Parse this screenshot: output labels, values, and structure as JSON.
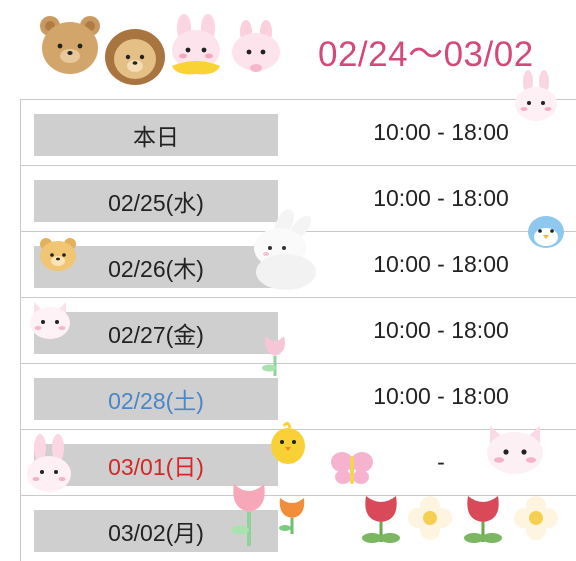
{
  "header": {
    "date_range": "02/24〜03/02",
    "date_color": "#d6487a"
  },
  "schedule": [
    {
      "day": "本日",
      "hours": "10:00 - 18:00",
      "day_color": "#222222"
    },
    {
      "day": "02/25(水)",
      "hours": "10:00 - 18:00",
      "day_color": "#222222"
    },
    {
      "day": "02/26(木)",
      "hours": "10:00 - 18:00",
      "day_color": "#222222"
    },
    {
      "day": "02/27(金)",
      "hours": "10:00 - 18:00",
      "day_color": "#222222"
    },
    {
      "day": "02/28(土)",
      "hours": "10:00 - 18:00",
      "day_color": "#4a86c8"
    },
    {
      "day": "03/01(日)",
      "hours": "-",
      "day_color": "#d32828"
    },
    {
      "day": "03/02(月)",
      "hours": "",
      "day_color": "#222222"
    }
  ],
  "icons": [
    "teddy-bear-icon",
    "lion-icon",
    "bunny-with-scarf-icon",
    "bunny-head-icon",
    "bunny-sticker-icon",
    "bird-icon",
    "bear-face-icon",
    "cat-icon",
    "tulip-icon",
    "chick-icon",
    "butterfly-icon",
    "flower-icon"
  ]
}
